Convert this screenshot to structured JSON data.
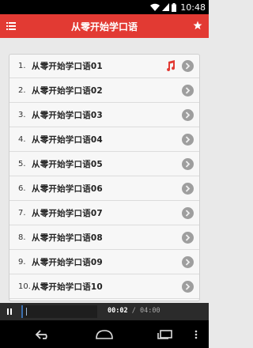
{
  "status_bar": {
    "time": "10:48"
  },
  "app_bar": {
    "title": "从零开始学口语",
    "menu_icon": "list-icon",
    "action_icon": "star-icon"
  },
  "list": {
    "items": [
      {
        "number": "1.",
        "title": "从零开始学口语01",
        "playing": true
      },
      {
        "number": "2.",
        "title": "从零开始学口语02",
        "playing": false
      },
      {
        "number": "3.",
        "title": "从零开始学口语03",
        "playing": false
      },
      {
        "number": "4.",
        "title": "从零开始学口语04",
        "playing": false
      },
      {
        "number": "5.",
        "title": "从零开始学口语05",
        "playing": false
      },
      {
        "number": "6.",
        "title": "从零开始学口语06",
        "playing": false
      },
      {
        "number": "7.",
        "title": "从零开始学口语07",
        "playing": false
      },
      {
        "number": "8.",
        "title": "从零开始学口语08",
        "playing": false
      },
      {
        "number": "9.",
        "title": "从零开始学口语09",
        "playing": false
      },
      {
        "number": "10.",
        "title": "从零开始学口语10",
        "playing": false
      }
    ]
  },
  "player": {
    "current_time": "00:02",
    "separator": "/",
    "total_time": "04:00",
    "progress": 0.02
  },
  "colors": {
    "accent": "#e23a33",
    "player_bg": "#2b2b2b",
    "progress_fill": "#3b6fb0"
  }
}
